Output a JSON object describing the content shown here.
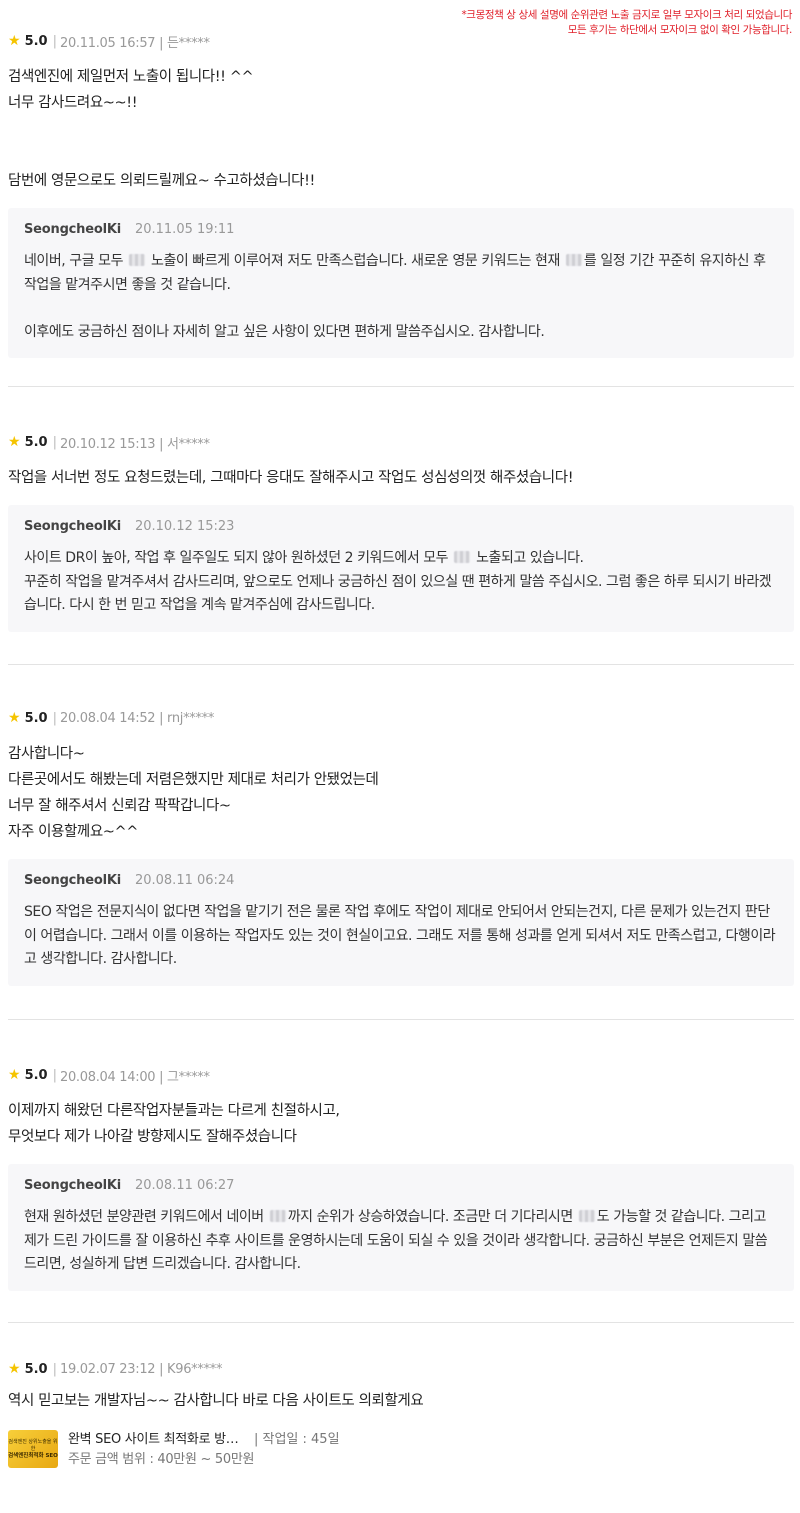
{
  "notice": {
    "line1": "*크몽정책 상 상세 설명에 순위관련 노출 금지로 일부 모자이크 처리 되었습니다",
    "line2": "모든 후기는 하단에서 모자이크 없이 확인 가능합니다."
  },
  "reviews": [
    {
      "rating": "5.0",
      "meta": "20.11.05 16:57 | 든*****",
      "lines": [
        "검색엔진에 제일먼저 노출이 됩니다!! ^^",
        "너무 감사드려요~~!!",
        "",
        "",
        "담번에 영문으로도 의뢰드릴께요~ 수고하셨습니다!!"
      ],
      "reply": {
        "name": "SeongcheolKi",
        "date": "20.11.05 19:11",
        "p1a": "네이버, 구글 모두 ",
        "p1b": " 노출이 빠르게 이루어져 저도 만족스럽습니다. 새로운 영문 키워드는 현재 ",
        "p1c": "를 일정 기간 꾸준히 유지하신 후 작업을 맡겨주시면 좋을 것 같습니다.",
        "p2": "이후에도 궁금하신 점이나 자세히 알고 싶은 사항이 있다면 편하게 말씀주십시오. 감사합니다."
      }
    },
    {
      "rating": "5.0",
      "meta": "20.10.12 15:13 | 서*****",
      "lines": [
        "작업을 서너번 정도 요청드렸는데, 그때마다 응대도 잘해주시고 작업도 성심성의껏 해주셨습니다!"
      ],
      "reply": {
        "name": "SeongcheolKi",
        "date": "20.10.12 15:23",
        "p1a": "사이트 DR이 높아, 작업 후 일주일도 되지 않아 원하셨던 2 키워드에서 모두 ",
        "p1b": " 노출되고 있습니다.",
        "p2": "꾸준히 작업을 맡겨주셔서 감사드리며, 앞으로도 언제나 궁금하신 점이 있으실 땐 편하게 말씀 주십시오. 그럼 좋은 하루 되시기 바라겠습니다. 다시 한 번 믿고 작업을 계속 맡겨주심에 감사드립니다."
      }
    },
    {
      "rating": "5.0",
      "meta": "20.08.04 14:52 | rnj*****",
      "lines": [
        "감사합니다~",
        "다른곳에서도 해봤는데 저렴은했지만 제대로 처리가 안됐었는데",
        "너무 잘 해주셔서 신뢰감 팍팍갑니다~",
        "자주 이용할께요~^^"
      ],
      "reply": {
        "name": "SeongcheolKi",
        "date": "20.08.11 06:24",
        "p1": "SEO 작업은 전문지식이 없다면 작업을 맡기기 전은 물론 작업 후에도 작업이 제대로 안되어서 안되는건지, 다른 문제가 있는건지 판단이 어렵습니다. 그래서 이를 이용하는 작업자도 있는 것이 현실이고요. 그래도 저를 통해 성과를 얻게 되셔서 저도 만족스럽고, 다행이라고 생각합니다. 감사합니다."
      }
    },
    {
      "rating": "5.0",
      "meta": "20.08.04 14:00 | 그*****",
      "lines": [
        "이제까지 해왔던 다른작업자분들과는 다르게 친절하시고,",
        "무엇보다 제가 나아갈 방향제시도 잘해주셨습니다"
      ],
      "reply": {
        "name": "SeongcheolKi",
        "date": "20.08.11 06:27",
        "p1a": "현재 원하셨던 분양관련 키워드에서 네이버 ",
        "p1b": "까지 순위가 상승하였습니다. 조금만 더 기다리시면 ",
        "p1c": "도 가능할 것 같습니다. 그리고 제가 드린 가이드를 잘 이용하신 추후 사이트를 운영하시는데 도움이 되실 수 있을 것이라 생각합니다. 궁금하신 부분은 언제든지 말씀드리면, 성실하게 답변 드리겠습니다. 감사합니다."
      }
    },
    {
      "rating": "5.0",
      "meta": "19.02.07 23:12 | K96*****",
      "lines": [
        "역시 믿고보는 개발자님~~ 감사합니다 바로 다음 사이트도 의뢰할게요"
      ]
    }
  ],
  "gig": {
    "thumb_top": "검색엔진 상위노출을 위한",
    "thumb_main": "검색엔진최적화 SEO",
    "title": "완벽 SEO 사이트 최적화로 방문자 유입",
    "days": "| 작업일 : 45일",
    "price": "주문 금액 범위 : 40만원 ~ 50만원"
  },
  "colors": {
    "star": "#f5c400",
    "notice": "#e0202a",
    "reply_bg": "#f7f7f9"
  },
  "icons": {
    "rating": "star-icon"
  }
}
